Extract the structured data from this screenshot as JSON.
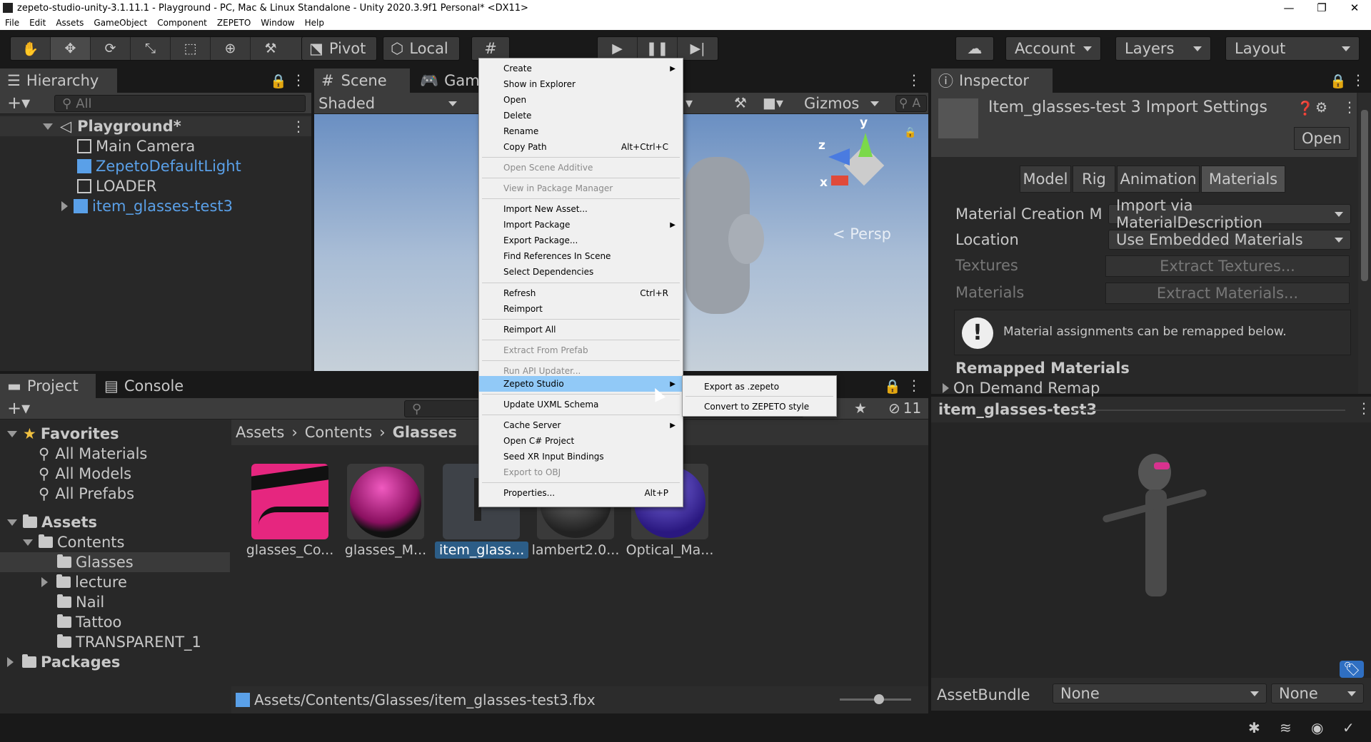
{
  "window": {
    "title": "zepeto-studio-unity-3.1.11.1 - Playground - PC, Mac & Linux Standalone - Unity 2020.3.9f1 Personal* <DX11>",
    "min": "—",
    "max": "❐",
    "close": "✕"
  },
  "menubar": [
    "File",
    "Edit",
    "Assets",
    "GameObject",
    "Component",
    "ZEPETO",
    "Window",
    "Help"
  ],
  "toolbar": {
    "pivot": "Pivot",
    "local": "Local",
    "account": "Account",
    "layers": "Layers",
    "layout": "Layout"
  },
  "hierarchy": {
    "tab": "Hierarchy",
    "search_placeholder": "All",
    "scene": "Playground*",
    "items": [
      "Main Camera",
      "ZepetoDefaultLight",
      "LOADER",
      "item_glasses-test3"
    ]
  },
  "scene_view": {
    "tab_scene": "Scene",
    "tab_game": "Game",
    "shading": "Shaded",
    "gizmos": "Gizmos",
    "persp": "< Persp",
    "axis_y": "y",
    "axis_z": "z",
    "axis_x": "x",
    "search_letter": "A"
  },
  "context_menu": {
    "items": [
      {
        "label": "Create",
        "sub": true
      },
      {
        "label": "Show in Explorer"
      },
      {
        "label": "Open"
      },
      {
        "label": "Delete"
      },
      {
        "label": "Rename"
      },
      {
        "label": "Copy Path",
        "shortcut": "Alt+Ctrl+C"
      },
      {
        "label": "Open Scene Additive",
        "disabled": true
      },
      {
        "label": "View in Package Manager",
        "disabled": true
      },
      {
        "label": "Import New Asset..."
      },
      {
        "label": "Import Package",
        "sub": true
      },
      {
        "label": "Export Package..."
      },
      {
        "label": "Find References In Scene"
      },
      {
        "label": "Select Dependencies"
      },
      {
        "label": "Refresh",
        "shortcut": "Ctrl+R"
      },
      {
        "label": "Reimport"
      },
      {
        "label": "Reimport All"
      },
      {
        "label": "Extract From Prefab",
        "disabled": true
      },
      {
        "label": "Run API Updater...",
        "disabled": true
      },
      {
        "label": "Zepeto Studio",
        "sub": true,
        "highlight": true
      },
      {
        "label": "Update UXML Schema"
      },
      {
        "label": "Cache Server",
        "sub": true
      },
      {
        "label": "Open C# Project"
      },
      {
        "label": "Seed XR Input Bindings"
      },
      {
        "label": "Export to OBJ",
        "disabled": true
      },
      {
        "label": "Properties...",
        "shortcut": "Alt+P"
      }
    ],
    "submenu": [
      "Export as .zepeto",
      "Convert to ZEPETO style"
    ]
  },
  "project": {
    "tab_project": "Project",
    "tab_console": "Console",
    "hidden_count": "11",
    "favorites": "Favorites",
    "fav_items": [
      "All Materials",
      "All Models",
      "All Prefabs"
    ],
    "assets": "Assets",
    "contents": "Contents",
    "folders": [
      "Glasses",
      "lecture",
      "Nail",
      "Tattoo",
      "TRANSPARENT_1"
    ],
    "packages": "Packages",
    "breadcrumb": [
      "Assets",
      "Contents",
      "Glasses"
    ],
    "thumbs": [
      "glasses_Co...",
      "glasses_M...",
      "item_glass...",
      "lambert2.0...",
      "Optical_Ma..."
    ],
    "status_path": "Assets/Contents/Glasses/item_glasses-test3.fbx"
  },
  "inspector": {
    "tab": "Inspector",
    "title": "Item_glasses-test 3 Import Settings",
    "open": "Open",
    "tabs": [
      "Model",
      "Rig",
      "Animation",
      "Materials"
    ],
    "rows": [
      {
        "label": "Material Creation Moc",
        "value": "Import via MaterialDescription"
      },
      {
        "label": "Location",
        "value": "Use Embedded Materials"
      }
    ],
    "textures_label": "Textures",
    "extract_textures": "Extract Textures...",
    "materials_label": "Materials",
    "extract_materials": "Extract Materials...",
    "info": "Material assignments can be remapped below.",
    "remapped": "Remapped Materials",
    "on_demand": "On Demand Remap",
    "preview_title": "item_glasses-test3",
    "assetbundle_label": "AssetBundle",
    "assetbundle_value": "None",
    "variant_value": "None"
  },
  "colors": {
    "accent_blue": "#5aa0e8",
    "highlight": "#91c9f7"
  }
}
